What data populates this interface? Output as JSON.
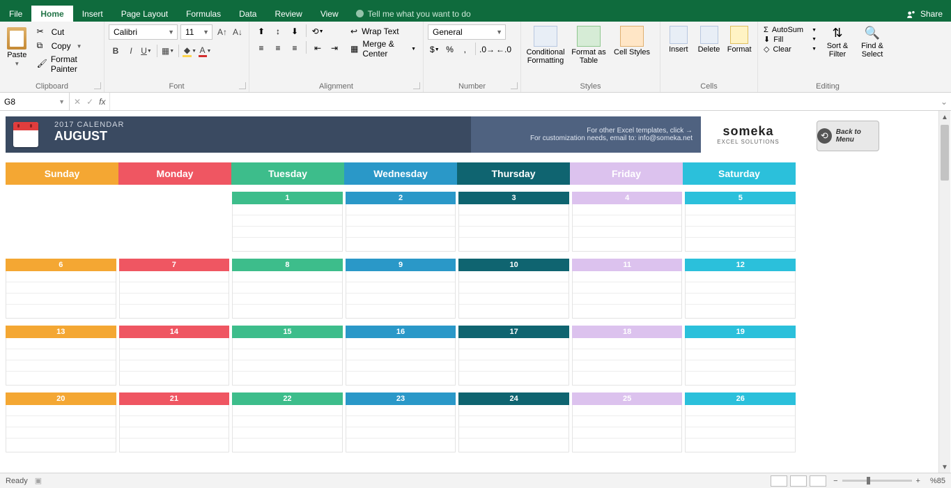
{
  "tabs": {
    "file": "File",
    "home": "Home",
    "insert": "Insert",
    "pagelayout": "Page Layout",
    "formulas": "Formulas",
    "data": "Data",
    "review": "Review",
    "view": "View",
    "tellme": "Tell me what you want to do",
    "share": "Share"
  },
  "ribbon": {
    "clipboard": {
      "label": "Clipboard",
      "paste": "Paste",
      "cut": "Cut",
      "copy": "Copy",
      "fmt": "Format Painter"
    },
    "font": {
      "label": "Font",
      "name": "Calibri",
      "size": "11"
    },
    "alignment": {
      "label": "Alignment",
      "wrap": "Wrap Text",
      "merge": "Merge & Center"
    },
    "number": {
      "label": "Number",
      "format": "General"
    },
    "styles": {
      "label": "Styles",
      "cond": "Conditional Formatting",
      "fmtas": "Format as Table",
      "cellst": "Cell Styles"
    },
    "cells": {
      "label": "Cells",
      "insert": "Insert",
      "delete": "Delete",
      "format": "Format"
    },
    "editing": {
      "label": "Editing",
      "autosum": "AutoSum",
      "fill": "Fill",
      "clear": "Clear",
      "sort": "Sort & Filter",
      "find": "Find & Select"
    }
  },
  "formulabar": {
    "namebox": "G8",
    "fx": "fx"
  },
  "calendar": {
    "year": "2017 CALENDAR",
    "month": "AUGUST",
    "msg1": "For other Excel templates, click →",
    "msg2": "For customization needs, email to: info@someka.net",
    "logo": "someka",
    "logosub": "EXCEL SOLUTIONS",
    "back": "Back to Menu",
    "days": [
      "Sunday",
      "Monday",
      "Tuesday",
      "Wednesday",
      "Thursday",
      "Friday",
      "Saturday"
    ],
    "weeks": [
      [
        "",
        "",
        "1",
        "2",
        "3",
        "4",
        "5"
      ],
      [
        "6",
        "7",
        "8",
        "9",
        "10",
        "11",
        "12"
      ],
      [
        "13",
        "14",
        "15",
        "16",
        "17",
        "18",
        "19"
      ],
      [
        "20",
        "21",
        "22",
        "23",
        "24",
        "25",
        "26"
      ]
    ]
  },
  "status": {
    "ready": "Ready",
    "zoom": "%85"
  }
}
